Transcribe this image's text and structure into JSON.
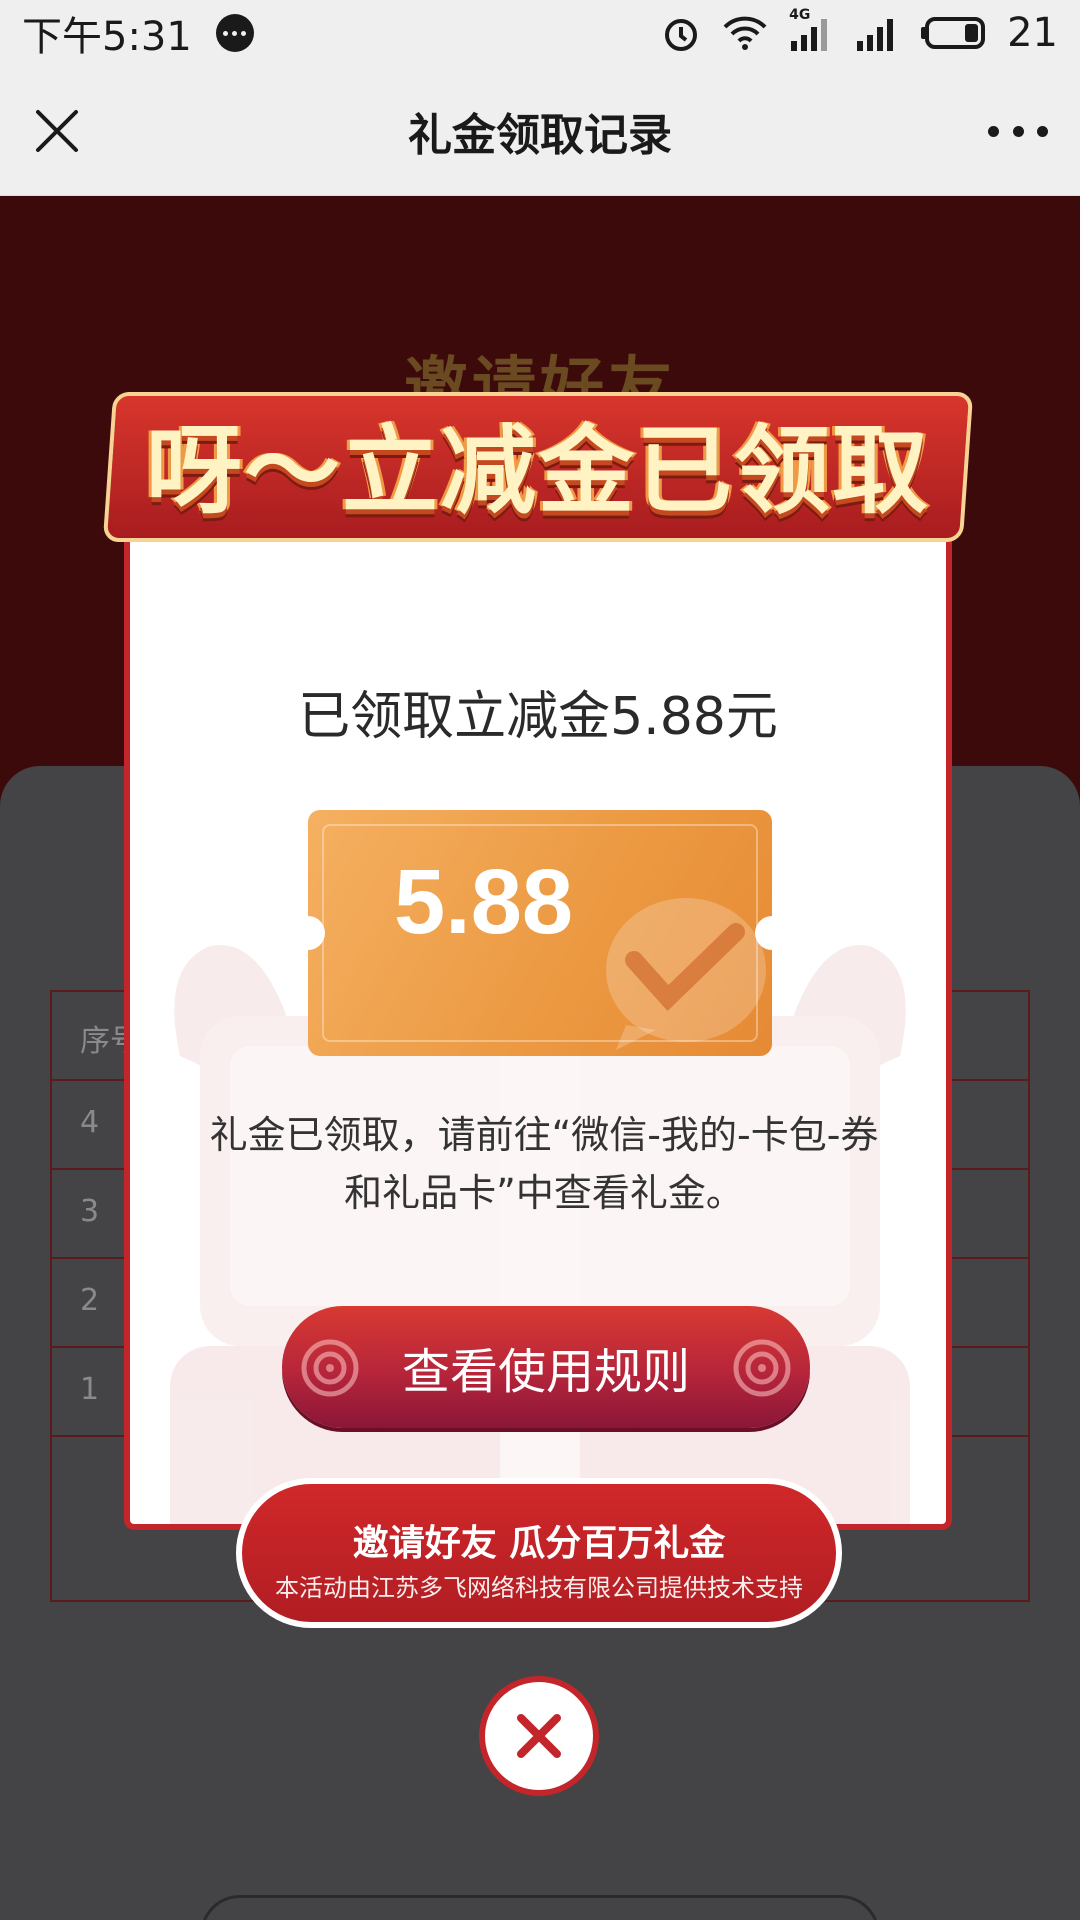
{
  "status_bar": {
    "time": "下午5:31",
    "network": "4G",
    "battery": "21",
    "icons": [
      "message-icon",
      "alarm-icon",
      "wifi-icon",
      "signal-icon",
      "signal-icon",
      "battery-icon"
    ]
  },
  "nav": {
    "title": "礼金领取记录",
    "close_icon": "close-icon",
    "more_icon": "more-icon"
  },
  "background": {
    "hero_text": "邀请好友",
    "table_rows": [
      "序号",
      "4",
      "3",
      "2",
      "1"
    ]
  },
  "modal": {
    "ribbon_title": "呀～立减金已领取",
    "claimed_text": "已领取立减金5.88元",
    "coupon_amount": "5.88",
    "notice_line1": "礼金已领取，请前往“微信-我的-卡包-券",
    "notice_line2": "和礼品卡”中查看礼金。",
    "rules_button": "查看使用规则",
    "plaque_title": "邀请好友 瓜分百万礼金",
    "plaque_subtitle": "本活动由江苏多飞网络科技有限公司提供技术支持"
  },
  "colors": {
    "accent_red": "#c3262a",
    "coupon_orange": "#ec9a43",
    "ribbon_gold": "#fff3c4"
  }
}
